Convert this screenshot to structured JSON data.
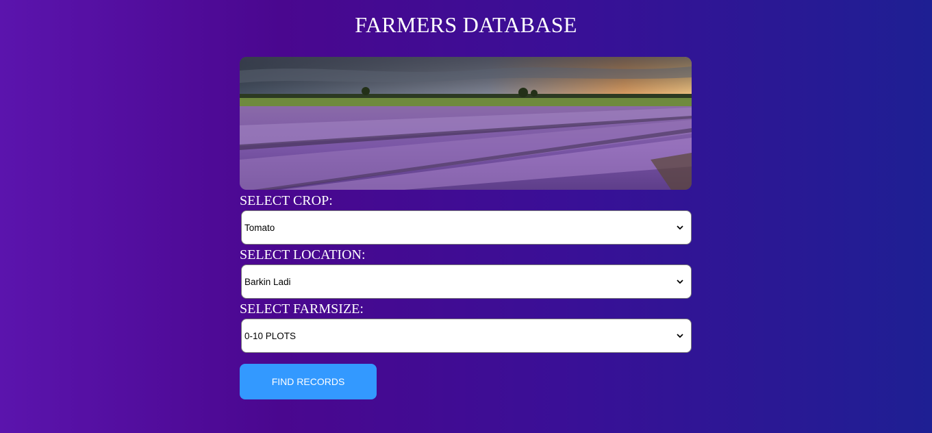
{
  "page": {
    "title": "FARMERS DATABASE"
  },
  "hero": {
    "image": "lavender-field-sunset"
  },
  "form": {
    "crop": {
      "label": "SELECT CROP:",
      "selected": "Tomato"
    },
    "location": {
      "label": "SELECT LOCATION:",
      "selected": "Barkin Ladi"
    },
    "farmsize": {
      "label": "SELECT FARMSIZE:",
      "selected": "0-10 PLOTS"
    },
    "submit_label": "FIND RECORDS"
  },
  "colors": {
    "background_left": "#5b14ad",
    "background_right": "#1e1f93",
    "button": "#3399ff",
    "text": "#ffffff"
  }
}
